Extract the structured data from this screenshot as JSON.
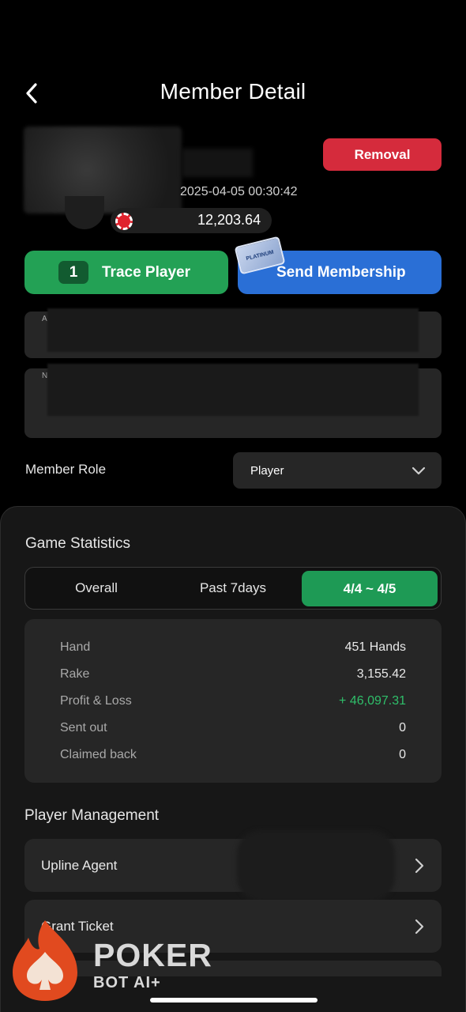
{
  "header": {
    "title": "Member Detail"
  },
  "member": {
    "last_active": "2025-04-05 00:30:42",
    "chips": "12,203.64",
    "removal_label": "Removal"
  },
  "actions": {
    "trace_count": "1",
    "trace_label": "Trace Player",
    "send_label": "Send Membership",
    "card_text": "PLATINUM"
  },
  "fields": {
    "field1_label": "A",
    "field2_label": "N"
  },
  "role": {
    "label": "Member Role",
    "value": "Player"
  },
  "stats": {
    "heading": "Game Statistics",
    "tabs": [
      {
        "label": "Overall"
      },
      {
        "label": "Past 7days"
      },
      {
        "label": "4/4 ~ 4/5"
      }
    ],
    "rows": [
      {
        "label": "Hand",
        "value": "451 Hands"
      },
      {
        "label": "Rake",
        "value": "3,155.42"
      },
      {
        "label": "Profit & Loss",
        "value": "+ 46,097.31"
      },
      {
        "label": "Sent out",
        "value": "0"
      },
      {
        "label": "Claimed back",
        "value": "0"
      }
    ]
  },
  "management": {
    "heading": "Player Management",
    "items": [
      {
        "label": "Upline Agent"
      },
      {
        "label": "Grant Ticket"
      }
    ]
  },
  "watermark": {
    "word": "POKER",
    "sub": "BOT AI+"
  },
  "colors": {
    "removal": "#d52b3c",
    "trace": "#23a155",
    "send": "#2a6fd6",
    "active_tab": "#1e9a55",
    "profit": "#2fbf6a"
  }
}
